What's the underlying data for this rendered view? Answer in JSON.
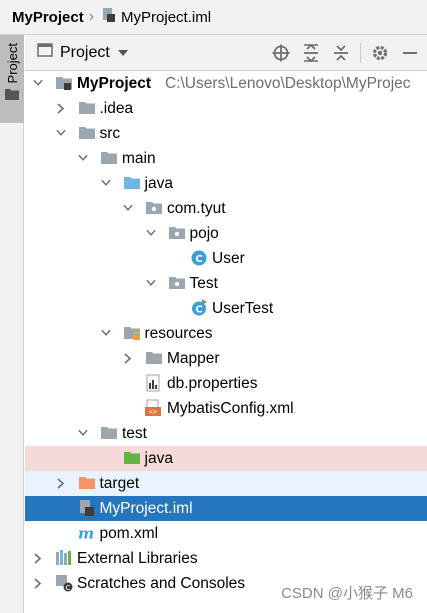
{
  "breadcrumb": {
    "project": "MyProject",
    "file": "MyProject.iml"
  },
  "stripe": {
    "label": "Project"
  },
  "toolwindow": {
    "selector_label": "Project",
    "icons": [
      "locate-icon",
      "expand-all-icon",
      "collapse-all-icon",
      "gear-icon",
      "minimize-icon"
    ]
  },
  "tree": [
    {
      "label": "MyProject",
      "path": "C:\\Users\\Lenovo\\Desktop\\MyProjec",
      "level": 0,
      "arrow": "down",
      "icon": "module-folder-icon",
      "bold": true
    },
    {
      "label": ".idea",
      "level": 1,
      "arrow": "right",
      "icon": "folder-icon"
    },
    {
      "label": "src",
      "level": 1,
      "arrow": "down",
      "icon": "folder-icon"
    },
    {
      "label": "main",
      "level": 2,
      "arrow": "down",
      "icon": "folder-icon"
    },
    {
      "label": "java",
      "level": 3,
      "arrow": "down",
      "icon": "source-folder-icon"
    },
    {
      "label": "com.tyut",
      "level": 4,
      "arrow": "down",
      "icon": "package-icon"
    },
    {
      "label": "pojo",
      "level": 5,
      "arrow": "down",
      "icon": "package-icon"
    },
    {
      "label": "User",
      "level": 6,
      "arrow": "none",
      "icon": "class-icon"
    },
    {
      "label": "Test",
      "level": 5,
      "arrow": "down",
      "icon": "package-icon"
    },
    {
      "label": "UserTest",
      "level": 6,
      "arrow": "none",
      "icon": "runnable-class-icon"
    },
    {
      "label": "resources",
      "level": 3,
      "arrow": "down",
      "icon": "resources-folder-icon"
    },
    {
      "label": "Mapper",
      "level": 4,
      "arrow": "right",
      "icon": "folder-icon"
    },
    {
      "label": "db.properties",
      "level": 4,
      "arrow": "none",
      "icon": "properties-file-icon"
    },
    {
      "label": "MybatisConfig.xml",
      "level": 4,
      "arrow": "none",
      "icon": "xml-file-icon"
    },
    {
      "label": "test",
      "level": 2,
      "arrow": "down",
      "icon": "folder-icon"
    },
    {
      "label": "java",
      "level": 3,
      "arrow": "none",
      "icon": "test-source-folder-icon",
      "highlight": "red"
    },
    {
      "label": "target",
      "level": 1,
      "arrow": "right",
      "icon": "excluded-folder-icon",
      "highlight": "blue"
    },
    {
      "label": "MyProject.iml",
      "level": 1,
      "arrow": "none",
      "icon": "iml-file-icon",
      "selected": true
    },
    {
      "label": "pom.xml",
      "level": 1,
      "arrow": "none",
      "icon": "maven-file-icon"
    },
    {
      "label": "External Libraries",
      "level": 0,
      "arrow": "right",
      "icon": "libraries-icon"
    },
    {
      "label": "Scratches and Consoles",
      "level": 0,
      "arrow": "right",
      "icon": "scratches-icon"
    }
  ],
  "watermark": "CSDN @小猴子 M6",
  "colors": {
    "selection": "#2675bf",
    "highlight_red": "#f6dada",
    "highlight_blue": "#eaf3fd",
    "folder": "#9aa7b0",
    "source_folder": "#6fb6e3",
    "test_folder": "#62b543",
    "excluded_folder": "#f4946b",
    "class": "#3e9fd8"
  }
}
